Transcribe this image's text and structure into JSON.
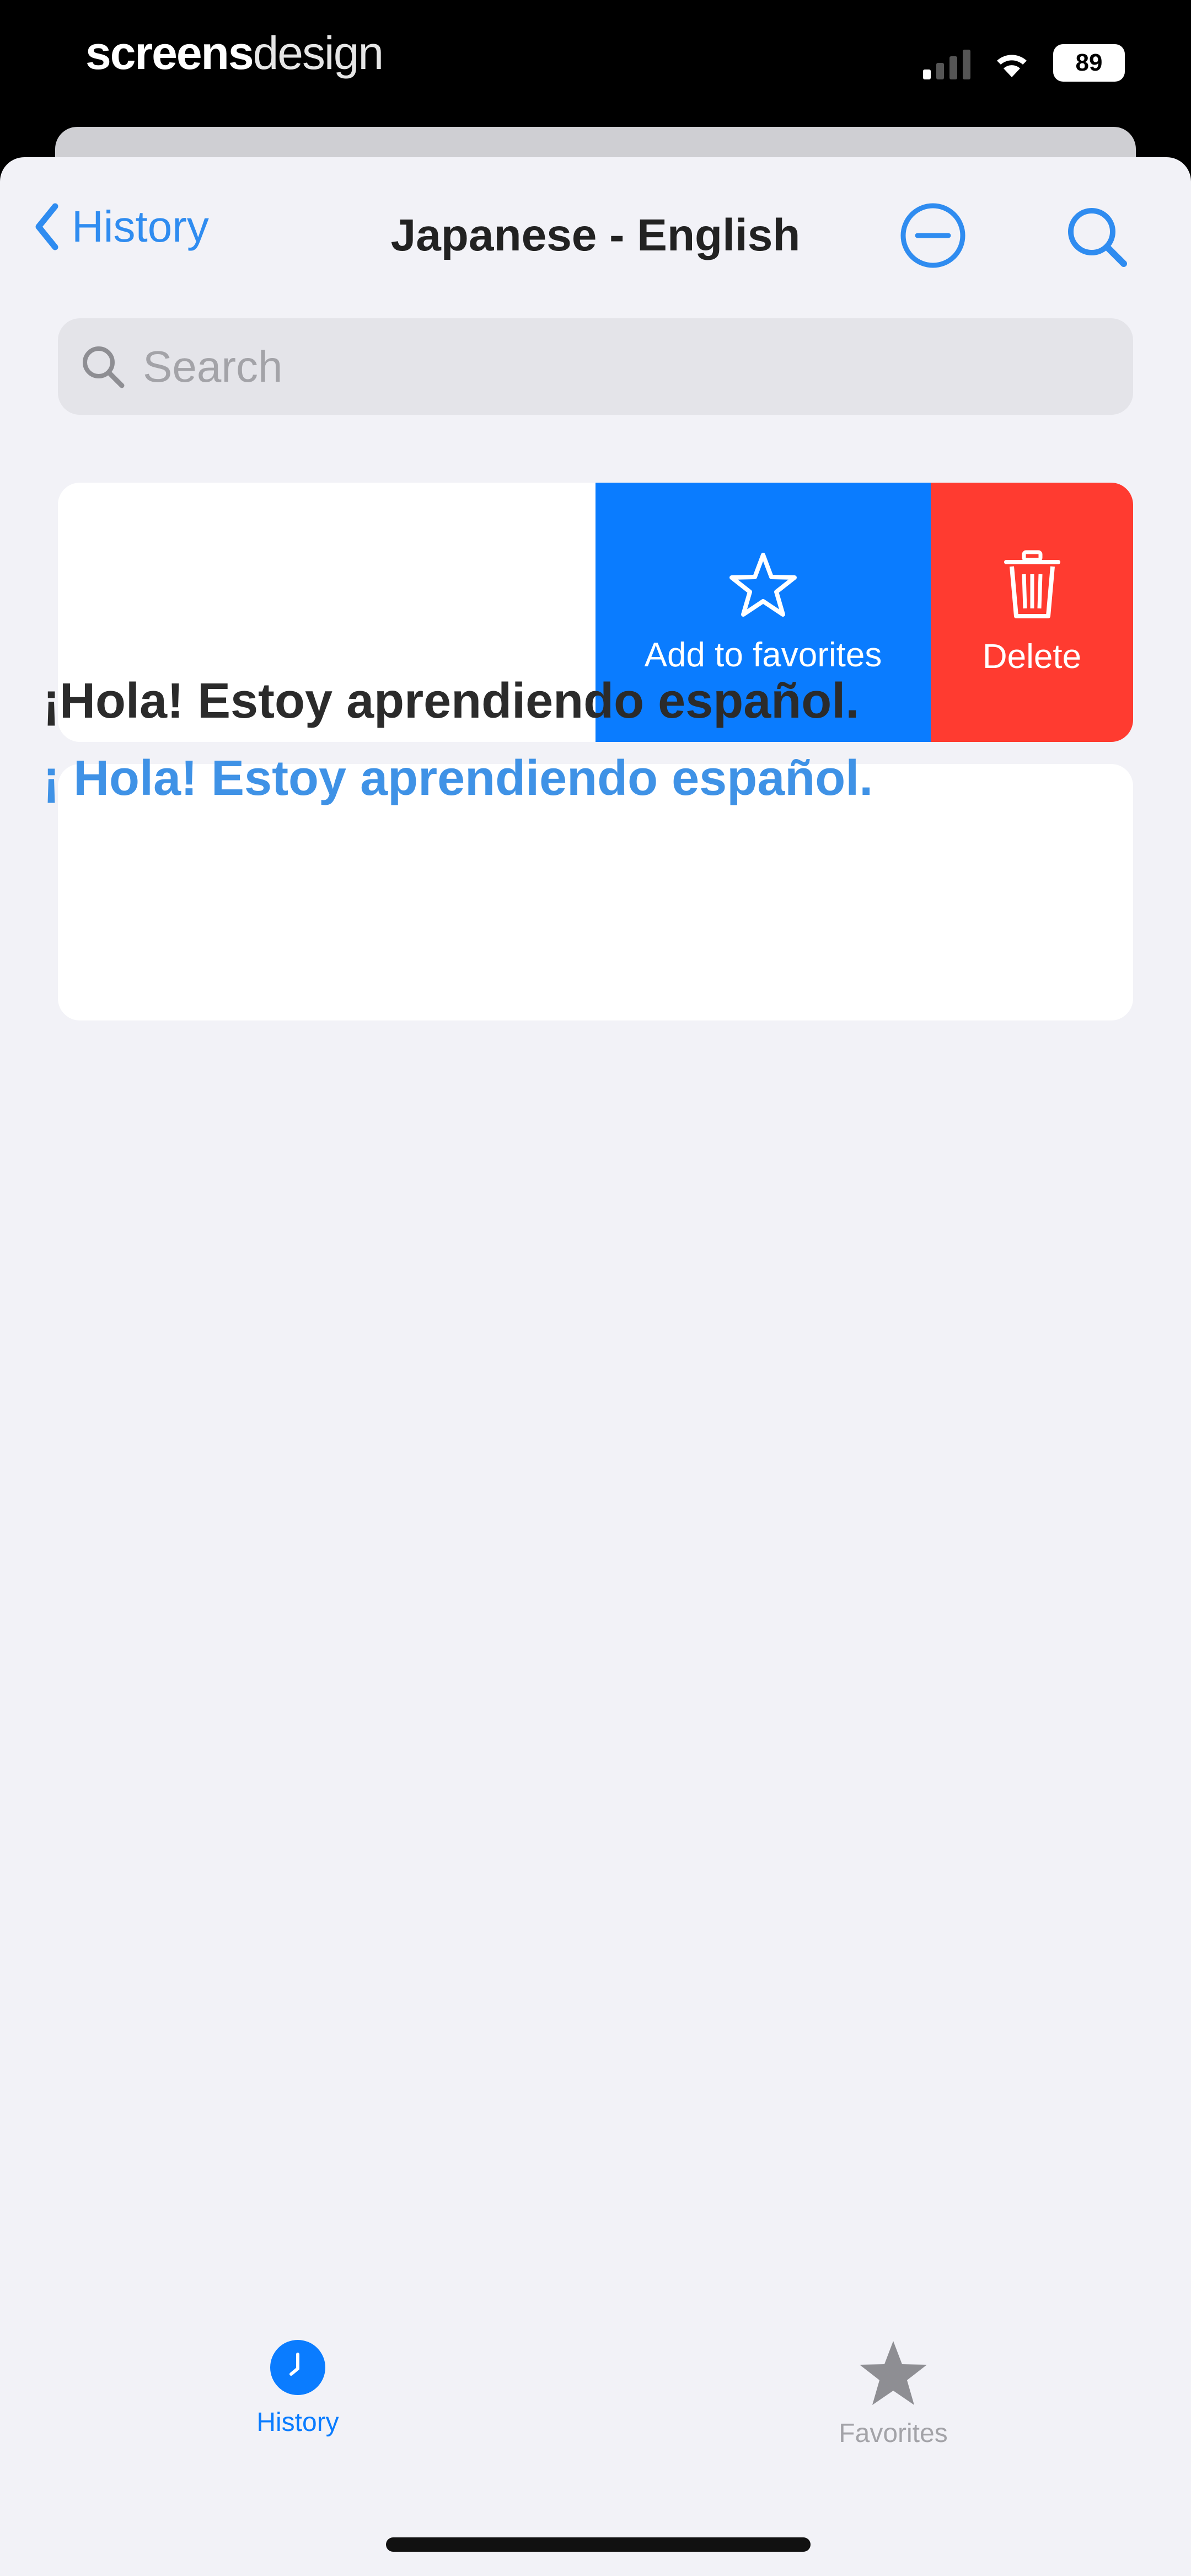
{
  "status_bar": {
    "brand_bold": "screens",
    "brand_light": "design",
    "battery": "89"
  },
  "nav": {
    "back_label": "History",
    "title": "Japanese - English"
  },
  "search": {
    "placeholder": "Search",
    "value": ""
  },
  "swipe_actions": {
    "favorite_label": "Add to favorites",
    "delete_label": "Delete"
  },
  "entries": [
    {
      "source": "¡Hola! Estoy aprendiendo español.",
      "translation": "¡ Hola! Estoy aprendiendo español."
    }
  ],
  "tabs": [
    {
      "label": "History",
      "selected": true
    },
    {
      "label": "Favorites",
      "selected": false
    }
  ],
  "colors": {
    "accent": "#0A7CFF",
    "link": "#2F8CF0",
    "destructive": "#FF3B30",
    "background": "#F2F2F7",
    "tab_inactive": "#8E8E93"
  }
}
